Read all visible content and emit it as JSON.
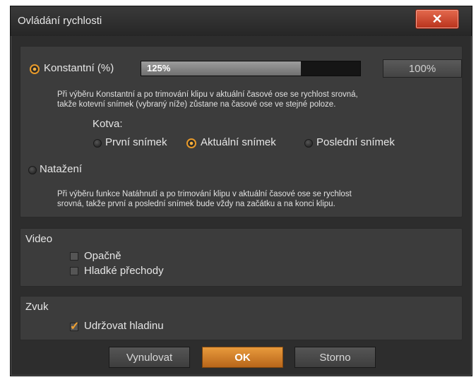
{
  "window": {
    "title": "Ovládání rychlosti",
    "close_symbol": "✕"
  },
  "speed": {
    "constant_label": "Konstantní (%)",
    "slider_value": "125%",
    "slider_fill": 0.73,
    "percent_field": "100%",
    "constant_desc_line1": "Při výběru Konstantní a po trimování klipu v aktuální časové ose se rychlost srovná,",
    "constant_desc_line2": "takže kotevní snímek (vybraný níže) zůstane na časové ose ve stejné poloze.",
    "anchor_label": "Kotva:",
    "anchor_options": [
      "První snímek",
      "Aktuální snímek",
      "Poslední snímek"
    ],
    "anchor_selected": "Aktuální snímek",
    "stretch_label": "Natažení",
    "stretch_desc_line1": "Při výběru funkce Natáhnutí a po trimování klipu v aktuální časové ose se rychlost",
    "stretch_desc_line2": "srovná, takže první a poslední snímek bude vždy na začátku a na konci klipu."
  },
  "video": {
    "label": "Video",
    "reverse_label": "Opačně",
    "smooth_label": "Hladké přechody"
  },
  "audio": {
    "label": "Zvuk",
    "keep_pitch_label": "Udržovat hladinu"
  },
  "buttons": {
    "reset": "Vynulovat",
    "ok": "OK",
    "cancel": "Storno"
  },
  "colors": {
    "accent": "#e8962e",
    "close": "#c9432a",
    "background": "#2d2d2d",
    "panel": "#3c3c3c"
  }
}
